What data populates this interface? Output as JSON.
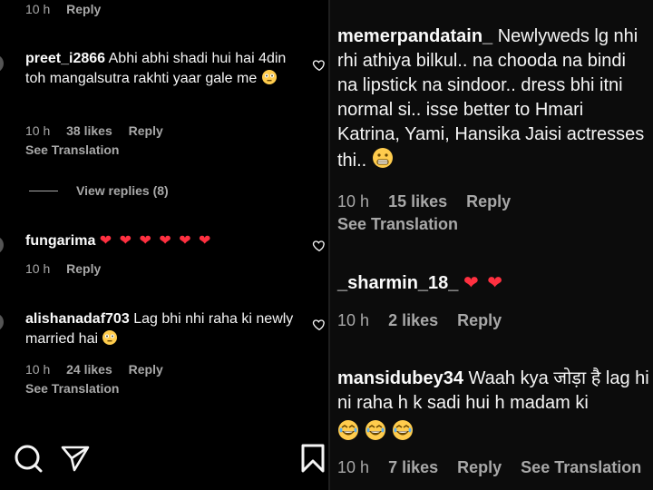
{
  "left": {
    "top_meta": {
      "time": "10 h",
      "reply": "Reply"
    },
    "comments": [
      {
        "username": "preet_i2866",
        "text": "Abhi abhi shadi hui hai 4din toh mangalsutra rakhti yaar gale me",
        "time": "10 h",
        "likes": "38 likes",
        "reply": "Reply",
        "see_translation": "See Translation"
      },
      {
        "username": "fungarima",
        "text": "❤ ❤ ❤ ❤ ❤ ❤",
        "time": "10 h",
        "reply": "Reply"
      },
      {
        "username": "alishanadaf703",
        "text": "Lag bhi nhi raha ki newly married hai",
        "time": "10 h",
        "likes": "24 likes",
        "reply": "Reply",
        "see_translation": "See Translation"
      }
    ],
    "view_replies": "View replies (8)"
  },
  "right": {
    "comments": [
      {
        "username": "memerpandatain_",
        "text": "Newlyweds lg nhi rhi athiya bilkul.. na chooda na bindi na lipstick na sindoor.. dress bhi itni normal si.. isse better to Hmari Katrina, Yami, Hansika Jaisi actresses thi..",
        "time": "10 h",
        "likes": "15 likes",
        "reply": "Reply",
        "see_translation": "See Translation"
      },
      {
        "username": "_sharmin_18_",
        "text": "❤ ❤",
        "time": "10 h",
        "likes": "2 likes",
        "reply": "Reply"
      },
      {
        "username": "mansidubey34",
        "text": "Waah kya जोड़ा है lag hi ni raha h k sadi hui h madam ki",
        "time": "10 h",
        "likes": "7 likes",
        "reply": "Reply",
        "see_translation": "See Translation"
      }
    ]
  },
  "icons": {
    "like": "heart-outline-icon",
    "search": "search-icon",
    "share": "send-icon",
    "save": "bookmark-icon",
    "heart_color": "#ff3040"
  }
}
